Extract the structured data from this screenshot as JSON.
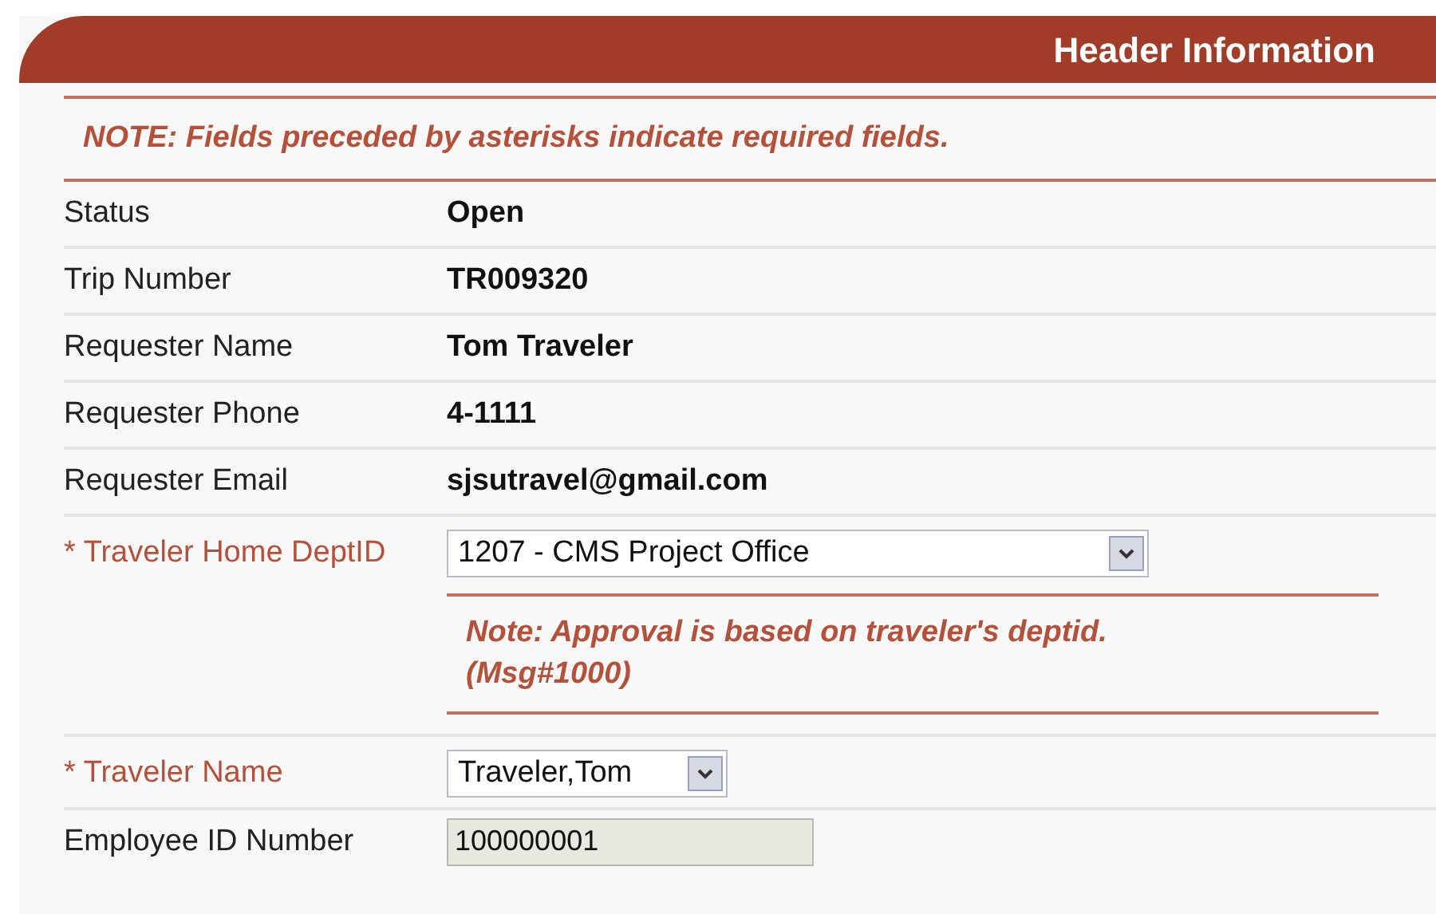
{
  "header": {
    "title": "Header Information"
  },
  "note": "NOTE: Fields preceded by asterisks indicate required fields.",
  "fields": [
    {
      "kind": "text",
      "label": "Status",
      "required": false,
      "value": "Open"
    },
    {
      "kind": "text",
      "label": "Trip Number",
      "required": false,
      "value": "TR009320"
    },
    {
      "kind": "text",
      "label": "Requester Name",
      "required": false,
      "value": "Tom Traveler"
    },
    {
      "kind": "text",
      "label": "Requester Phone",
      "required": false,
      "value": "4-1111"
    },
    {
      "kind": "text",
      "label": "Requester Email",
      "required": false,
      "value": "sjsutravel@gmail.com"
    },
    {
      "kind": "select",
      "label": "* Traveler Home DeptID",
      "required": true,
      "value": "1207 - CMS Project Office",
      "wide": true,
      "message": "Note: Approval is based on traveler's deptid. (Msg#1000)"
    },
    {
      "kind": "select",
      "label": "* Traveler Name",
      "required": true,
      "value": "Traveler,Tom",
      "wide": false
    },
    {
      "kind": "readonly",
      "label": "Employee ID Number",
      "required": false,
      "value": "100000001"
    }
  ]
}
